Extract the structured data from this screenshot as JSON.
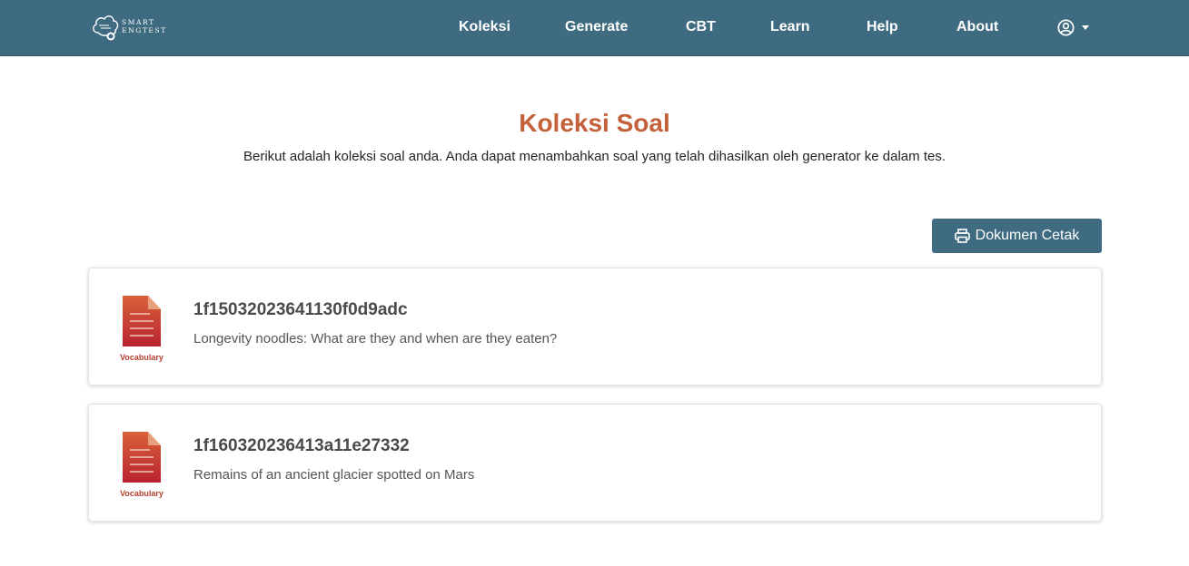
{
  "brand": {
    "line1": "SMART",
    "line2": "ENGTEST",
    "icon": "cloud-logo-icon"
  },
  "nav": {
    "items": [
      {
        "label": "Koleksi"
      },
      {
        "label": "Generate"
      },
      {
        "label": "CBT"
      },
      {
        "label": "Learn"
      },
      {
        "label": "Help"
      },
      {
        "label": "About"
      }
    ],
    "user_icon": "user-circle-icon"
  },
  "page": {
    "title": "Koleksi Soal",
    "subtitle": "Berikut adalah koleksi soal anda. Anda dapat menambahkan soal yang telah dihasilkan oleh generator ke dalam tes."
  },
  "print_button": {
    "label": "Dokumen Cetak",
    "icon": "printer-icon"
  },
  "collections": [
    {
      "id": "1f15032023641130f0d9adc",
      "description": "Longevity noodles: What are they and when are they eaten?",
      "category": "Vocabulary",
      "icon": "document-icon"
    },
    {
      "id": "1f160320236413a11e27332",
      "description": "Remains of an ancient glacier spotted on Mars",
      "category": "Vocabulary",
      "icon": "document-icon"
    }
  ],
  "colors": {
    "navbar": "#3f6b80",
    "title": "#c4603a",
    "button": "#3f6b80",
    "doc_icon": "#c0392b"
  }
}
